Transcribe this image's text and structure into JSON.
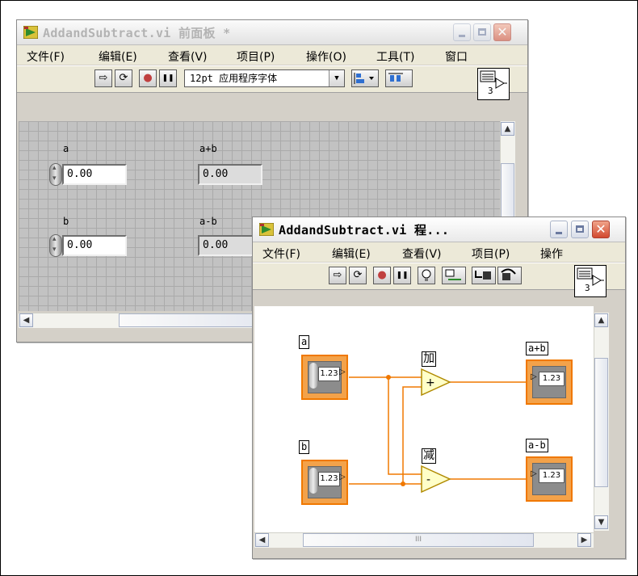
{
  "front_panel": {
    "title": "AddandSubtract.vi 前面板 *",
    "menu": [
      "文件(F)",
      "编辑(E)",
      "查看(V)",
      "项目(P)",
      "操作(O)",
      "工具(T)",
      "窗口"
    ],
    "font_select": "12pt 应用程序字体",
    "vi_icon_number": "3",
    "controls": [
      {
        "label": "a",
        "value": "0.00"
      },
      {
        "label": "b",
        "value": "0.00"
      }
    ],
    "indicators": [
      {
        "label": "a+b",
        "value": "0.00"
      },
      {
        "label": "a-b",
        "value": "0.00"
      }
    ]
  },
  "block_diagram": {
    "title": "AddandSubtract.vi 程...",
    "menu": [
      "文件(F)",
      "编辑(E)",
      "查看(V)",
      "项目(P)",
      "操作"
    ],
    "vi_icon_number": "3",
    "terminals": {
      "a": {
        "label": "a",
        "value": "1.23"
      },
      "b": {
        "label": "b",
        "value": "1.23"
      },
      "sum": {
        "label": "a+b",
        "value": "1.23"
      },
      "diff": {
        "label": "a-b",
        "value": "1.23"
      }
    },
    "nodes": {
      "add": {
        "label": "加",
        "symbol": "+"
      },
      "subtract": {
        "label": "减",
        "symbol": "-"
      }
    },
    "scroll_grip": "III",
    "wire_color": "#f07800"
  },
  "icons": {
    "run": "⇨",
    "run_continuous": "⟳",
    "abort": "●",
    "pause": "❚❚",
    "highlight": "💡",
    "close": "✕",
    "scroll_up": "▲",
    "scroll_down": "▼",
    "scroll_left": "◀",
    "scroll_right": "▶"
  }
}
